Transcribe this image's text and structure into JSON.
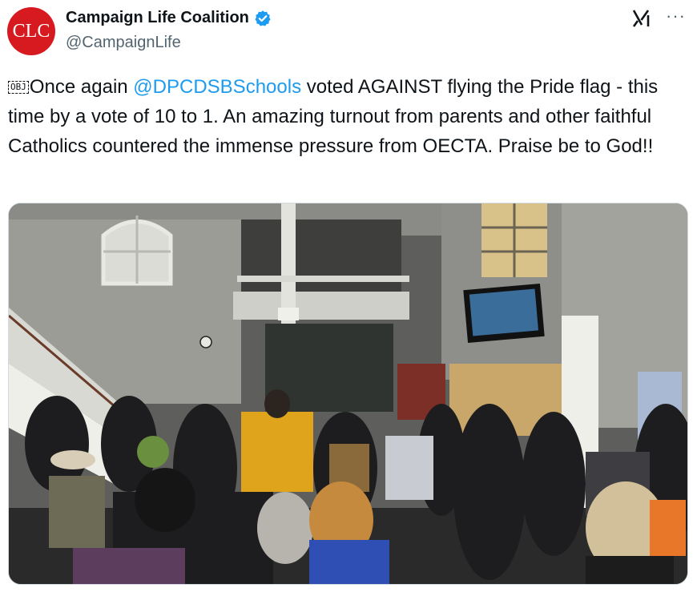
{
  "author": {
    "avatar_text": "CLC",
    "display_name": "Campaign Life Coalition",
    "handle": "@CampaignLife",
    "verified": true
  },
  "icons": {
    "grok": "grok-icon",
    "more": "more-icon",
    "verified": "verified-badge-icon"
  },
  "tweet": {
    "obj_glyph": "OBJ",
    "text_before": "Once again ",
    "mention": "@DPCDSBSchools",
    "text_after": " voted AGAINST flying the Pride flag - this time by a vote of 10 to 1. An amazing turnout from parents and other faithful Catholics countered the immense pressure from OECTA. Praise be to God!!"
  },
  "more_label": "···",
  "colors": {
    "avatar_bg": "#d71920",
    "link": "#1d9bf0",
    "verified": "#1d9bf0",
    "secondary_text": "#536471"
  }
}
